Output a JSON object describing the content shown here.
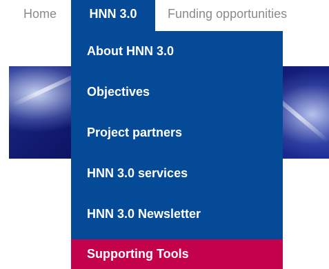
{
  "nav": {
    "home": "Home",
    "hnn": "HNN 3.0",
    "funding": "Funding opportunities"
  },
  "dropdown": {
    "items": [
      "About HNN 3.0",
      "Objectives",
      "Project partners",
      "HNN 3.0 services",
      "HNN 3.0 Newsletter",
      "Supporting Tools"
    ],
    "active_item": "Supporting Tools"
  },
  "colors": {
    "menu_blue": "#054a96",
    "active_pink": "#c4024b",
    "nav_gray": "#8a8a8a"
  }
}
